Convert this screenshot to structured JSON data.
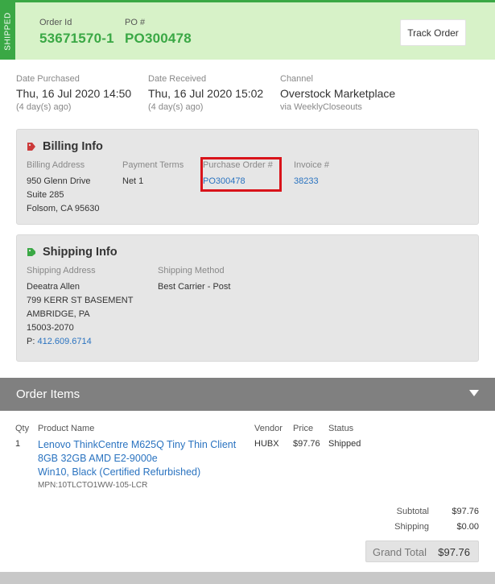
{
  "header": {
    "status_tag": "SHIPPED",
    "order_id_label": "Order Id",
    "order_id": "53671570-1",
    "po_label": "PO #",
    "po_number": "PO300478",
    "track_button": "Track Order"
  },
  "dates": {
    "purchased_label": "Date Purchased",
    "purchased_value": "Thu, 16 Jul 2020 14:50",
    "purchased_sub": "(4 day(s) ago)",
    "received_label": "Date Received",
    "received_value": "Thu, 16 Jul 2020 15:02",
    "received_sub": "(4 day(s) ago)",
    "channel_label": "Channel",
    "channel_value": "Overstock Marketplace",
    "channel_sub": "via WeeklyCloseouts"
  },
  "billing": {
    "title": "Billing Info",
    "address_label": "Billing Address",
    "address_lines": [
      "950 Glenn Drive",
      "Suite 285",
      "Folsom, CA 95630"
    ],
    "terms_label": "Payment Terms",
    "terms_value": "Net 1",
    "po_label": "Purchase Order #",
    "po_value": "PO300478",
    "invoice_label": "Invoice #",
    "invoice_value": "38233"
  },
  "shipping": {
    "title": "Shipping Info",
    "address_label": "Shipping Address",
    "address_lines": [
      "Deeatra Allen",
      "799 KERR ST BASEMENT",
      "AMBRIDGE, PA",
      "15003-2070"
    ],
    "phone_prefix": "P:",
    "phone": "412.609.6714",
    "method_label": "Shipping Method",
    "method_value": "Best Carrier - Post"
  },
  "order_items": {
    "title": "Order Items",
    "columns": {
      "qty": "Qty",
      "product": "Product Name",
      "vendor": "Vendor",
      "price": "Price",
      "status": "Status"
    },
    "rows": [
      {
        "qty": "1",
        "product_lines": [
          "Lenovo ThinkCentre M625Q Tiny Thin Client",
          "8GB 32GB AMD E2-9000e",
          "Win10, Black (Certified Refurbished)"
        ],
        "mpn": "MPN:10TLCTO1WW-105-LCR",
        "vendor": "HUBX",
        "price": "$97.76",
        "status": "Shipped"
      }
    ],
    "totals": {
      "subtotal_label": "Subtotal",
      "subtotal": "$97.76",
      "shipping_label": "Shipping",
      "shipping": "$0.00",
      "grand_label": "Grand Total",
      "grand": "$97.76"
    }
  },
  "colors": {
    "accent_green": "#3aa845",
    "header_bg": "#d7f2c8",
    "link_blue": "#2a73c0",
    "highlight_red": "#d9131a",
    "billing_icon": "#cc3a3a"
  },
  "icons": {
    "billing": "tag-icon",
    "shipping": "shipping-tag-icon",
    "collapse": "caret-down-icon"
  }
}
